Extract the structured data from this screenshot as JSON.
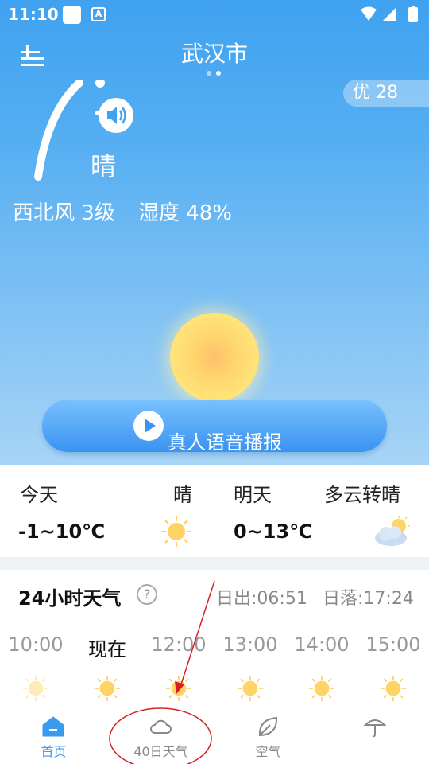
{
  "status_bar": {
    "time": "11:10"
  },
  "header": {
    "city": "武汉市"
  },
  "current": {
    "aqi": "优 28",
    "condition": "晴",
    "wind": "西北风 3级",
    "humidity": "湿度 48%"
  },
  "voice_button": {
    "label": "真人语音播报"
  },
  "forecast": {
    "today": {
      "label": "今天",
      "condition": "晴",
      "temp": "-1~10℃",
      "icon": "sunny-icon"
    },
    "tomorrow": {
      "label": "明天",
      "condition": "多云转晴",
      "temp": "0~13℃",
      "icon": "partly-cloudy-icon"
    }
  },
  "hourly": {
    "title": "24小时天气",
    "sunrise": "日出:06:51",
    "sunset": "日落:17:24",
    "hours": [
      {
        "label": "10:00",
        "icon": "sunny-icon"
      },
      {
        "label": "现在",
        "icon": "sunny-icon"
      },
      {
        "label": "12:00",
        "icon": "sunny-icon"
      },
      {
        "label": "13:00",
        "icon": "sunny-icon"
      },
      {
        "label": "14:00",
        "icon": "sunny-icon"
      },
      {
        "label": "15:00",
        "icon": "sunny-icon"
      }
    ]
  },
  "nav": {
    "items": [
      {
        "label": "首页",
        "icon": "home-icon",
        "active": true
      },
      {
        "label": "40日天气",
        "icon": "cloud-icon",
        "active": false
      },
      {
        "label": "空气",
        "icon": "leaf-icon",
        "active": false
      },
      {
        "label": "",
        "icon": "umbrella-icon",
        "active": false
      }
    ]
  },
  "colors": {
    "accent": "#3a9af0",
    "annotation": "#d42020"
  }
}
